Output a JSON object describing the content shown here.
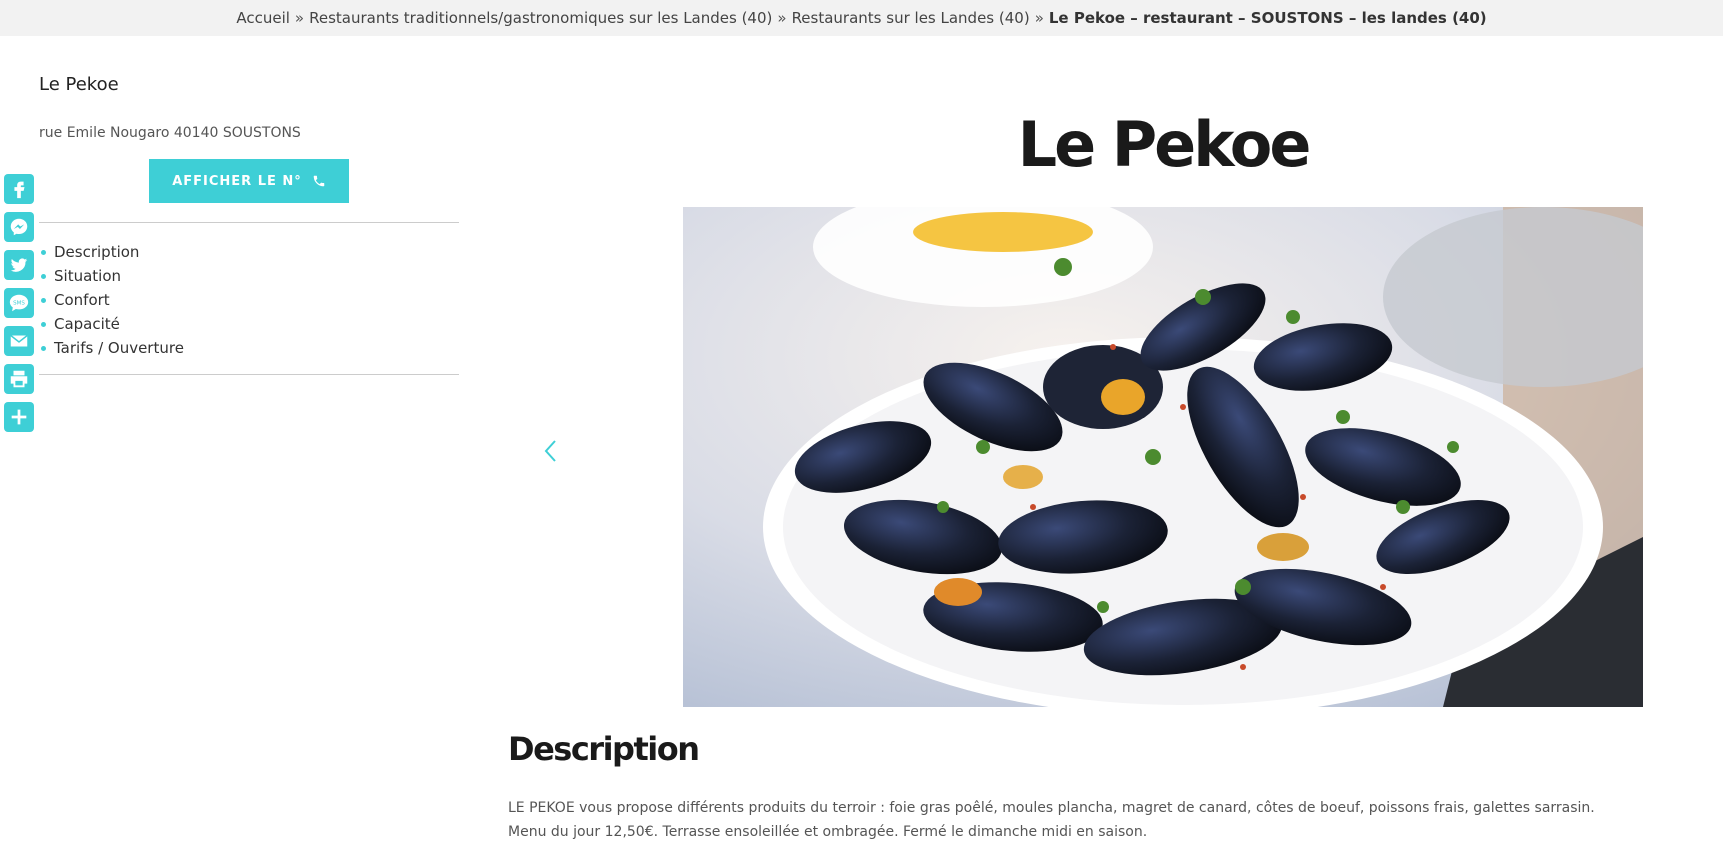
{
  "breadcrumb": {
    "items": [
      "Accueil",
      "Restaurants traditionnels/gastronomiques sur les Landes (40)",
      "Restaurants sur les Landes (40)"
    ],
    "separator": "»",
    "current": "Le Pekoe – restaurant – SOUSTONS – les landes (40)"
  },
  "share": {
    "color": "#3ecfd6",
    "icons": [
      "facebook-icon",
      "messenger-icon",
      "twitter-icon",
      "sms-icon",
      "email-icon",
      "print-icon",
      "add-icon"
    ]
  },
  "sidebar": {
    "title": "Le Pekoe",
    "address": "rue Emile Nougaro 40140 SOUSTONS",
    "phone_button": "AFFICHER LE N°",
    "toc": [
      "Description",
      "Situation",
      "Confort",
      "Capacité",
      "Tarifs / Ouverture"
    ]
  },
  "main": {
    "title": "Le Pekoe",
    "image_subject": "mussels-dish",
    "description_heading": "Description",
    "description_line1": "LE PEKOE vous propose différents produits du terroir : foie gras poêlé, moules plancha, magret de canard, côtes de boeuf, poissons frais, galettes sarrasin.",
    "description_line2": "Menu du jour 12,50€. Terrasse ensoleillée et ombragée. Fermé le dimanche midi en saison."
  },
  "colors": {
    "accent": "#3ecfd6",
    "breadcrumb_bg": "#f2f2f2",
    "heading": "#1a1a1a"
  }
}
